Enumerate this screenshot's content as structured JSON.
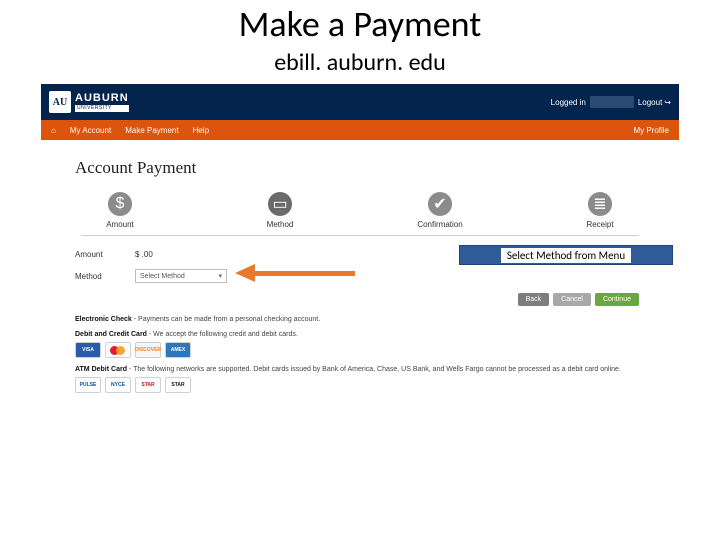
{
  "slide": {
    "title": "Make a Payment",
    "subtitle": "ebill. auburn. edu"
  },
  "brand": {
    "badge": "AU",
    "name": "AUBURN",
    "unit": "UNIVERSITY"
  },
  "topbar": {
    "logged_in": "Logged in",
    "logout": "Logout"
  },
  "nav": {
    "home_icon": "⌂",
    "my_account": "My Account",
    "make_payment": "Make Payment",
    "help": "Help",
    "my_profile": "My Profile"
  },
  "page": {
    "title": "Account Payment"
  },
  "steps": [
    {
      "label": "Amount",
      "icon": "$",
      "active": false
    },
    {
      "label": "Method",
      "icon": "▭",
      "active": true
    },
    {
      "label": "Confirmation",
      "icon": "✔",
      "active": false
    },
    {
      "label": "Receipt",
      "icon": "≣",
      "active": false
    }
  ],
  "form": {
    "amount_label": "Amount",
    "amount_value": "$ .00",
    "method_label": "Method",
    "method_placeholder": "Select Method"
  },
  "callout": {
    "text": "Select Method from Menu"
  },
  "actions": {
    "back": "Back",
    "cancel": "Cancel",
    "continue": "Continue"
  },
  "info": {
    "echeck_title": "Electronic Check",
    "echeck_text": " - Payments can be made from a personal checking account.",
    "cc_title": "Debit and Credit Card",
    "cc_text": " - We accept the following credit and debit cards.",
    "atm_title": "ATM Debit Card",
    "atm_text": " - The following networks are supported. Debit cards issued by Bank of America, Chase, US Bank, and Wells Fargo cannot be processed as a debit card online."
  },
  "cards_credit": [
    "VISA",
    "",
    "DISCOVER",
    "AMEX"
  ],
  "cards_debit": [
    "PULSE",
    "NYCE",
    "STAR",
    "STAR"
  ]
}
